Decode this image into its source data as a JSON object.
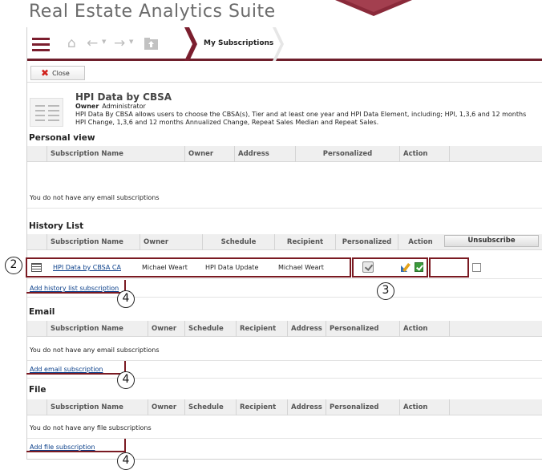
{
  "app": {
    "title": "Real Estate Analytics Suite"
  },
  "breadcrumb": {
    "current": "My Subscriptions"
  },
  "toolbar": {
    "close_label": "Close"
  },
  "report": {
    "title": "HPI Data by CBSA",
    "owner_label": "Owner",
    "owner_value": "Administrator",
    "description": "HPI Data By CBSA allows users to choose the CBSA(s), Tier and at least one year and HPI Data Element, including; HPI, 1,3,6 and 12 months HPI Change, 1,3,6 and 12 months Annualized Change, Repeat Sales Median and Repeat Sales."
  },
  "personal_view": {
    "title": "Personal view",
    "columns": [
      "Subscription Name",
      "Owner",
      "Address",
      "Personalized",
      "Action"
    ],
    "empty_text": "You do not have any email subscriptions"
  },
  "history_list": {
    "title": "History List",
    "columns": [
      "Subscription Name",
      "Owner",
      "Schedule",
      "Recipient",
      "Personalized",
      "Action"
    ],
    "unsubscribe_label": "Unsubscribe",
    "rows": [
      {
        "name": "HPI Data by CBSA CA",
        "owner": "Michael Weart",
        "schedule": "HPI Data Update",
        "recipient": "Michael Weart"
      }
    ],
    "add_link": "Add history list subscription"
  },
  "email": {
    "title": "Email",
    "columns": [
      "Subscription Name",
      "Owner",
      "Schedule",
      "Recipient",
      "Address",
      "Personalized",
      "Action"
    ],
    "empty_text": "You do not have any email subscriptions",
    "add_link": "Add email subscription"
  },
  "file": {
    "title": "File",
    "columns": [
      "Subscription Name",
      "Owner",
      "Schedule",
      "Recipient",
      "Address",
      "Personalized",
      "Action"
    ],
    "empty_text": "You do not have any file subscriptions",
    "add_link": "Add file subscription"
  },
  "callouts": {
    "row": "2",
    "actions": "3",
    "add_link": "4"
  },
  "colors": {
    "brand": "#6e1f2b",
    "annotation": "#7a1a22",
    "link": "#0a3f8a"
  },
  "icons": [
    "menu-icon",
    "home-icon",
    "back-icon",
    "forward-icon",
    "folder-up-icon",
    "close-icon",
    "report-icon",
    "grid-icon",
    "personalized-check-icon",
    "edit-icon",
    "run-now-icon"
  ]
}
